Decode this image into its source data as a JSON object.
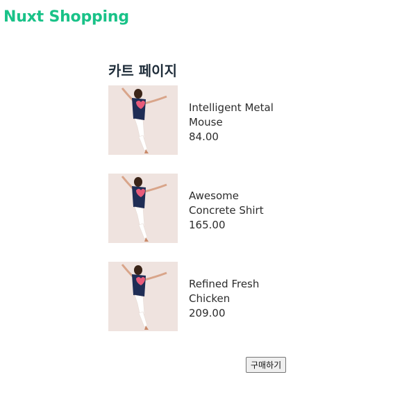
{
  "header": {
    "brand": "Nuxt Shopping"
  },
  "cart": {
    "title": "카트 페이지",
    "items": [
      {
        "name": "Intelligent Metal Mouse",
        "price": "84.00"
      },
      {
        "name": "Awesome Concrete Shirt",
        "price": "165.00"
      },
      {
        "name": "Refined Fresh Chicken",
        "price": "209.00"
      }
    ],
    "buy_label": "구매하기"
  },
  "colors": {
    "brand": "#19c288",
    "photo_background": "#efe3df",
    "shirt": "#1f2d55",
    "heart": "#e85b7a"
  }
}
